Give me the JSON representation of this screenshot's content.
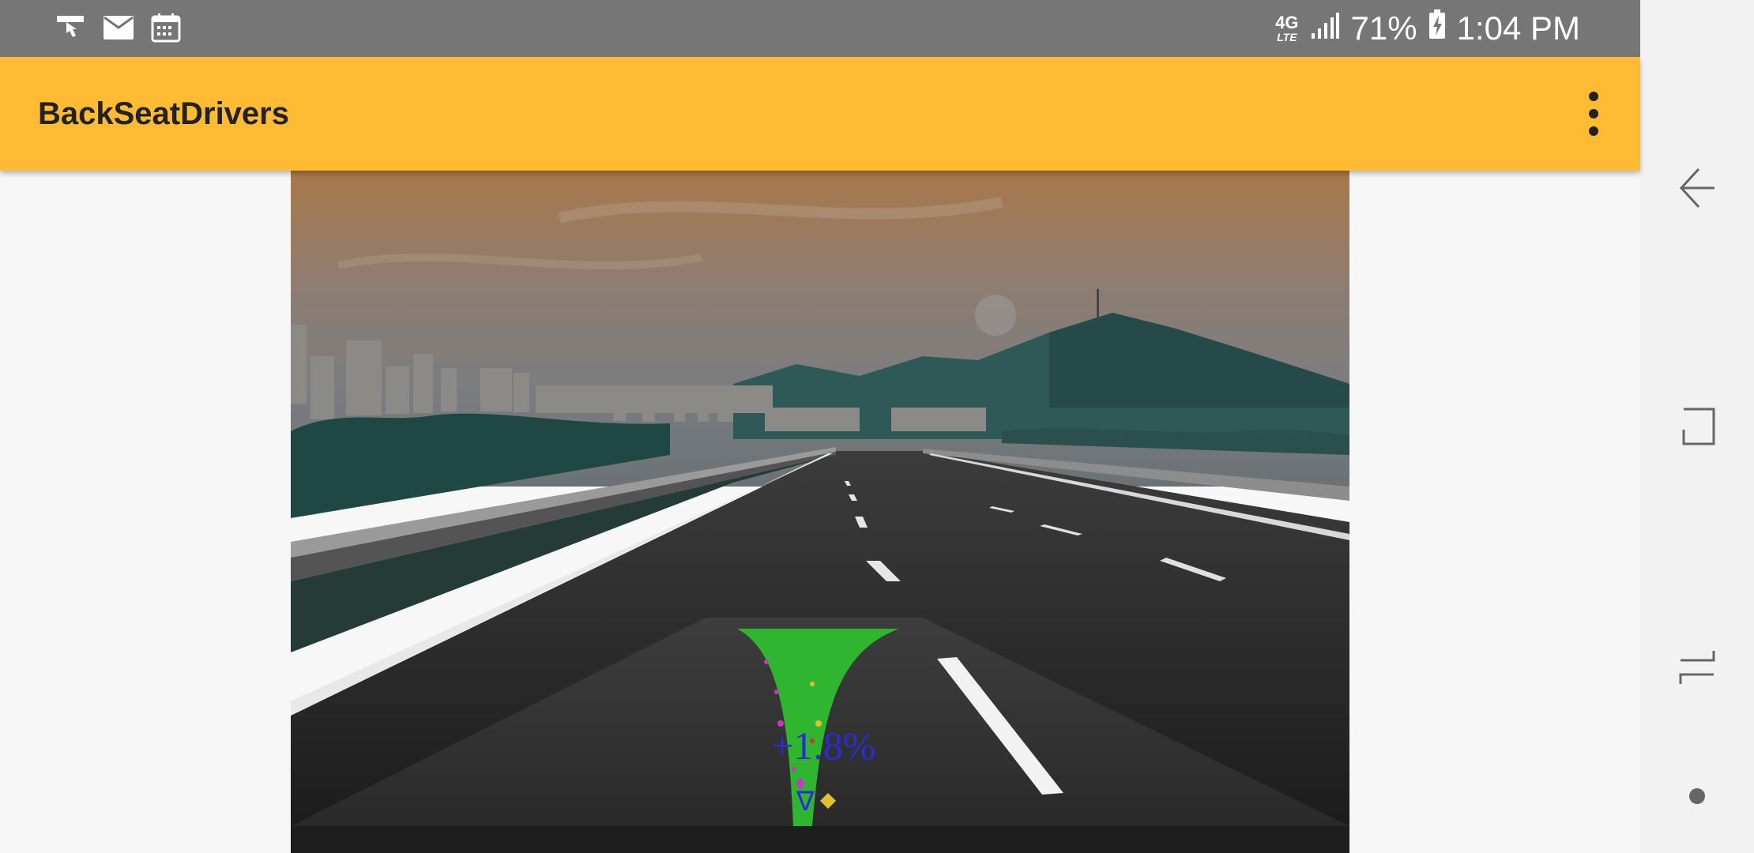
{
  "status_bar": {
    "notification_icons": [
      "gesture-notification-icon",
      "mail-icon",
      "calendar-icon"
    ],
    "network": "4G",
    "network_sub": "LTE",
    "battery_percent": "71%",
    "time": "1:04 PM"
  },
  "app_bar": {
    "title": "BackSeatDrivers",
    "menu_icon": "more-vert-icon"
  },
  "camera_view": {
    "overlay_text": "+1.8%",
    "overlay_marker": "∇",
    "path_color": "#2fb52f",
    "accent_color": "#ffbb33"
  },
  "nav_bar": {
    "buttons": [
      "back-icon",
      "overview-icon",
      "recents-icon",
      "assistant-dot-icon"
    ]
  }
}
